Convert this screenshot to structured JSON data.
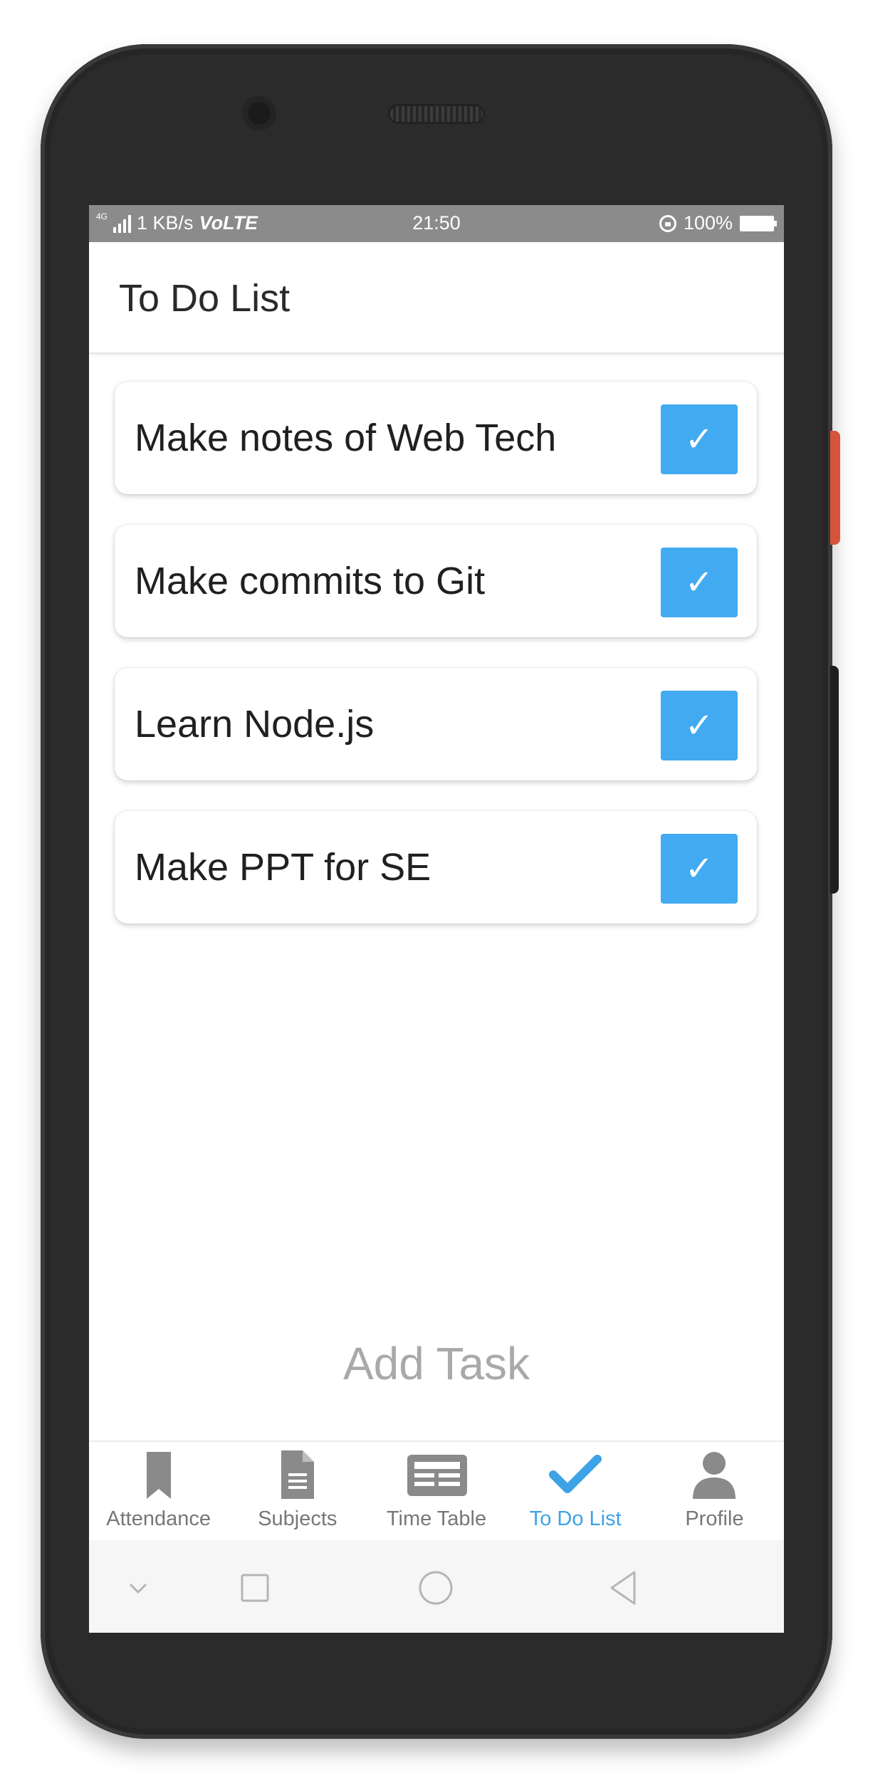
{
  "status_bar": {
    "network": "4G",
    "speed": "1 KB/s",
    "volte": "VoLTE",
    "time": "21:50",
    "battery": "100%"
  },
  "header": {
    "title": "To Do List"
  },
  "tasks": [
    {
      "label": "Make notes of Web Tech",
      "checked": true,
      "check_glyph": "✓"
    },
    {
      "label": "Make commits to Git",
      "checked": true,
      "check_glyph": "✓"
    },
    {
      "label": "Learn Node.js",
      "checked": true,
      "check_glyph": "✓"
    },
    {
      "label": "Make PPT for SE",
      "checked": true,
      "check_glyph": "✓"
    }
  ],
  "add_task": {
    "label": "Add Task"
  },
  "tab_bar": {
    "active_tab": "To Do List",
    "tabs": [
      {
        "label": "Attendance",
        "icon": "bookmark-icon"
      },
      {
        "label": "Subjects",
        "icon": "document-icon"
      },
      {
        "label": "Time Table",
        "icon": "newspaper-icon"
      },
      {
        "label": "To Do List",
        "icon": "check-icon"
      },
      {
        "label": "Profile",
        "icon": "user-icon"
      }
    ]
  },
  "nav_bar": {
    "buttons": [
      "chevron-down-icon",
      "recents-icon",
      "home-icon",
      "back-icon"
    ]
  },
  "colors": {
    "accent": "#42aaf0",
    "active_tab": "#3ea2e6",
    "inactive_tab": "#777777",
    "status_bar": "#8b8b8b",
    "add_task_text": "#a9a9a9"
  }
}
